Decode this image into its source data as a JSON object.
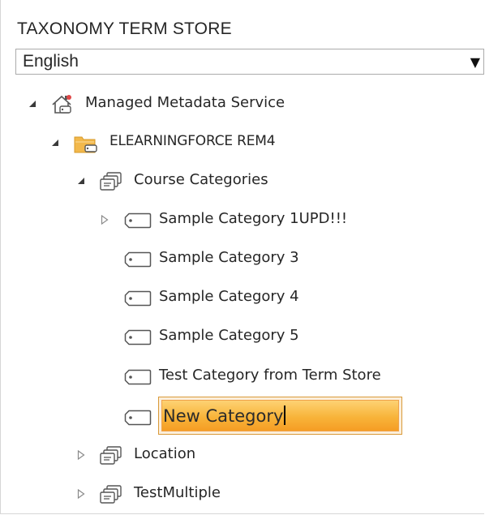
{
  "panel": {
    "title": "TAXONOMY TERM STORE",
    "language": {
      "selected": "English"
    }
  },
  "tree": {
    "service": {
      "label": "Managed Metadata Service",
      "expanded": true,
      "icon": "metadata-service-icon"
    },
    "group": {
      "label": "ELEARNINGFORCE REM4",
      "expanded": true,
      "icon": "term-group-folder-icon"
    },
    "termsets": [
      {
        "label": "Course Categories",
        "expanded": true,
        "icon": "term-set-icon"
      },
      {
        "label": "Location",
        "expanded": false,
        "icon": "term-set-icon"
      },
      {
        "label": "TestMultiple",
        "expanded": false,
        "icon": "term-set-icon"
      }
    ],
    "terms": [
      {
        "label": "Sample Category 1UPD!!!",
        "has_children": true
      },
      {
        "label": "Sample Category 3",
        "has_children": false
      },
      {
        "label": "Sample Category 4",
        "has_children": false
      },
      {
        "label": "Sample Category 5",
        "has_children": false
      },
      {
        "label": "Test Category from Term Store",
        "has_children": false
      }
    ],
    "new_term": {
      "value": "New Category"
    }
  },
  "colors": {
    "edit_highlight": "#f8b43a",
    "edit_border": "#d99a3a",
    "folder": "#f2b84b",
    "text": "#262626"
  }
}
